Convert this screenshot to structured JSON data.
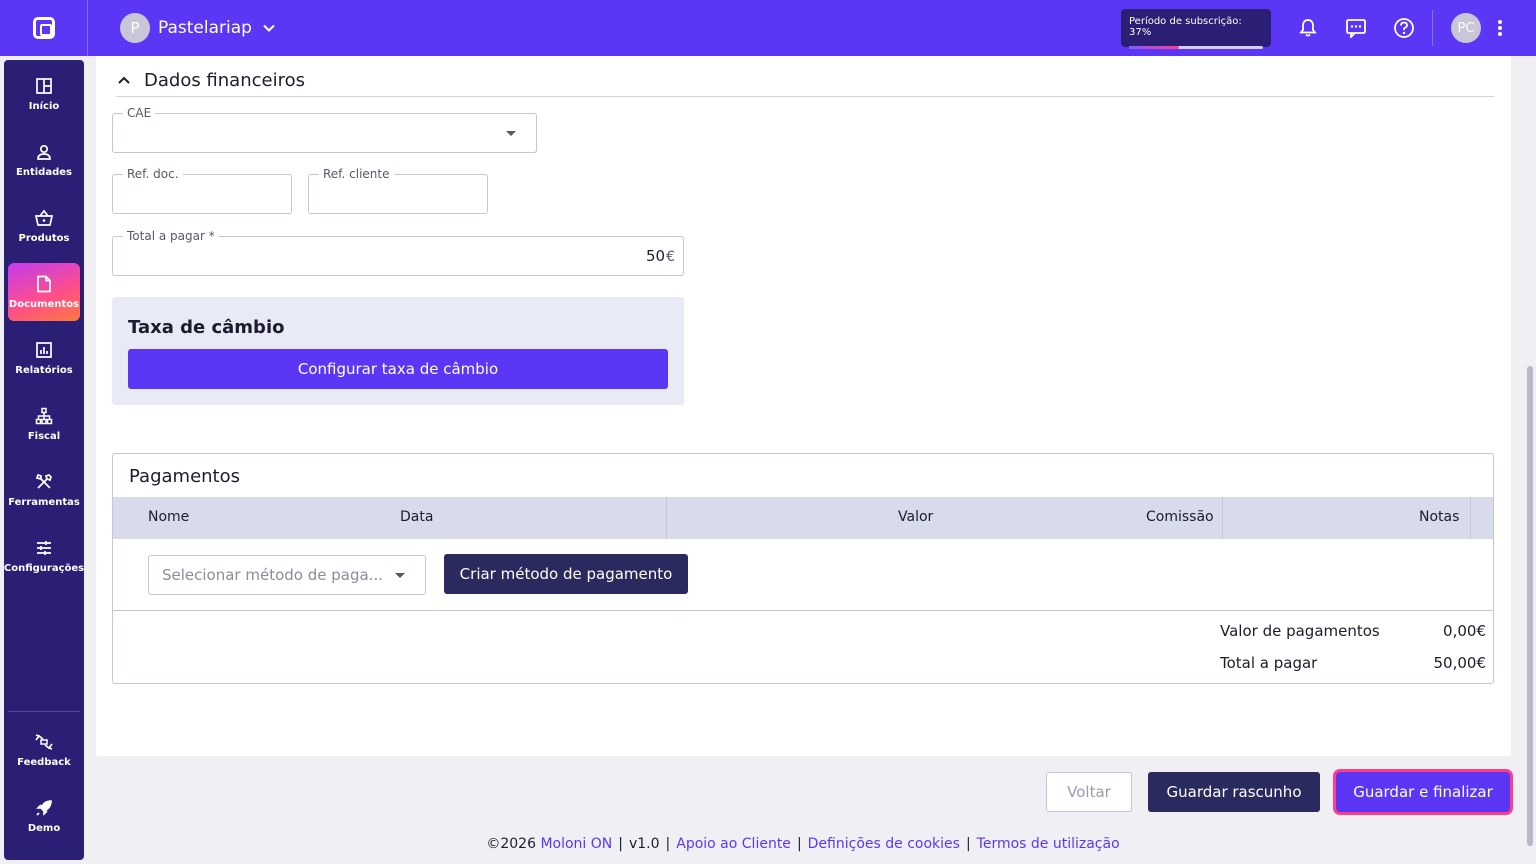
{
  "header": {
    "company_initial": "P",
    "company_name": "Pastelariap",
    "subscription_label": "Período de subscrição: 37%",
    "subscription_percent": 37,
    "user_initials": "PC"
  },
  "sidebar": {
    "items": [
      {
        "label": "Início",
        "icon": "home-grid-icon"
      },
      {
        "label": "Entidades",
        "icon": "person-icon"
      },
      {
        "label": "Produtos",
        "icon": "basket-icon"
      },
      {
        "label": "Documentos",
        "icon": "document-icon",
        "active": true
      },
      {
        "label": "Relatórios",
        "icon": "chart-icon"
      },
      {
        "label": "Fiscal",
        "icon": "hierarchy-icon"
      },
      {
        "label": "Ferramentas",
        "icon": "tools-icon"
      },
      {
        "label": "Configurações",
        "icon": "sliders-icon"
      }
    ],
    "bottom": [
      {
        "label": "Feedback",
        "icon": "feedback-icon"
      },
      {
        "label": "Demo",
        "icon": "rocket-icon"
      }
    ]
  },
  "financial": {
    "section_title": "Dados financeiros",
    "cae_label": "CAE",
    "ref_doc_label": "Ref. doc.",
    "ref_client_label": "Ref. cliente",
    "total_label": "Total a pagar *",
    "total_value": "50",
    "currency": "€"
  },
  "exchange": {
    "title": "Taxa de câmbio",
    "button": "Configurar taxa de câmbio"
  },
  "payments": {
    "title": "Pagamentos",
    "columns": [
      "Nome",
      "Data",
      "Valor",
      "Comissão",
      "Notas"
    ],
    "method_placeholder": "Selecionar método de paga...",
    "create_button": "Criar método de pagamento",
    "summary": [
      {
        "label": "Valor de pagamentos",
        "value": "0,00€"
      },
      {
        "label": "Total a pagar",
        "value": "50,00€"
      }
    ]
  },
  "actions": {
    "back": "Voltar",
    "draft": "Guardar rascunho",
    "finalize": "Guardar e finalizar"
  },
  "footer": {
    "copyright": "©2026",
    "brand": "Moloni ON",
    "version": "v1.0",
    "support": "Apoio ao Cliente",
    "cookies": "Definições de cookies",
    "terms": "Termos de utilização"
  },
  "colors": {
    "primary": "#5b36f5",
    "dark": "#2a1f74",
    "navy_button": "#2a2a5e",
    "accent_pink": "#ff3d8b"
  }
}
